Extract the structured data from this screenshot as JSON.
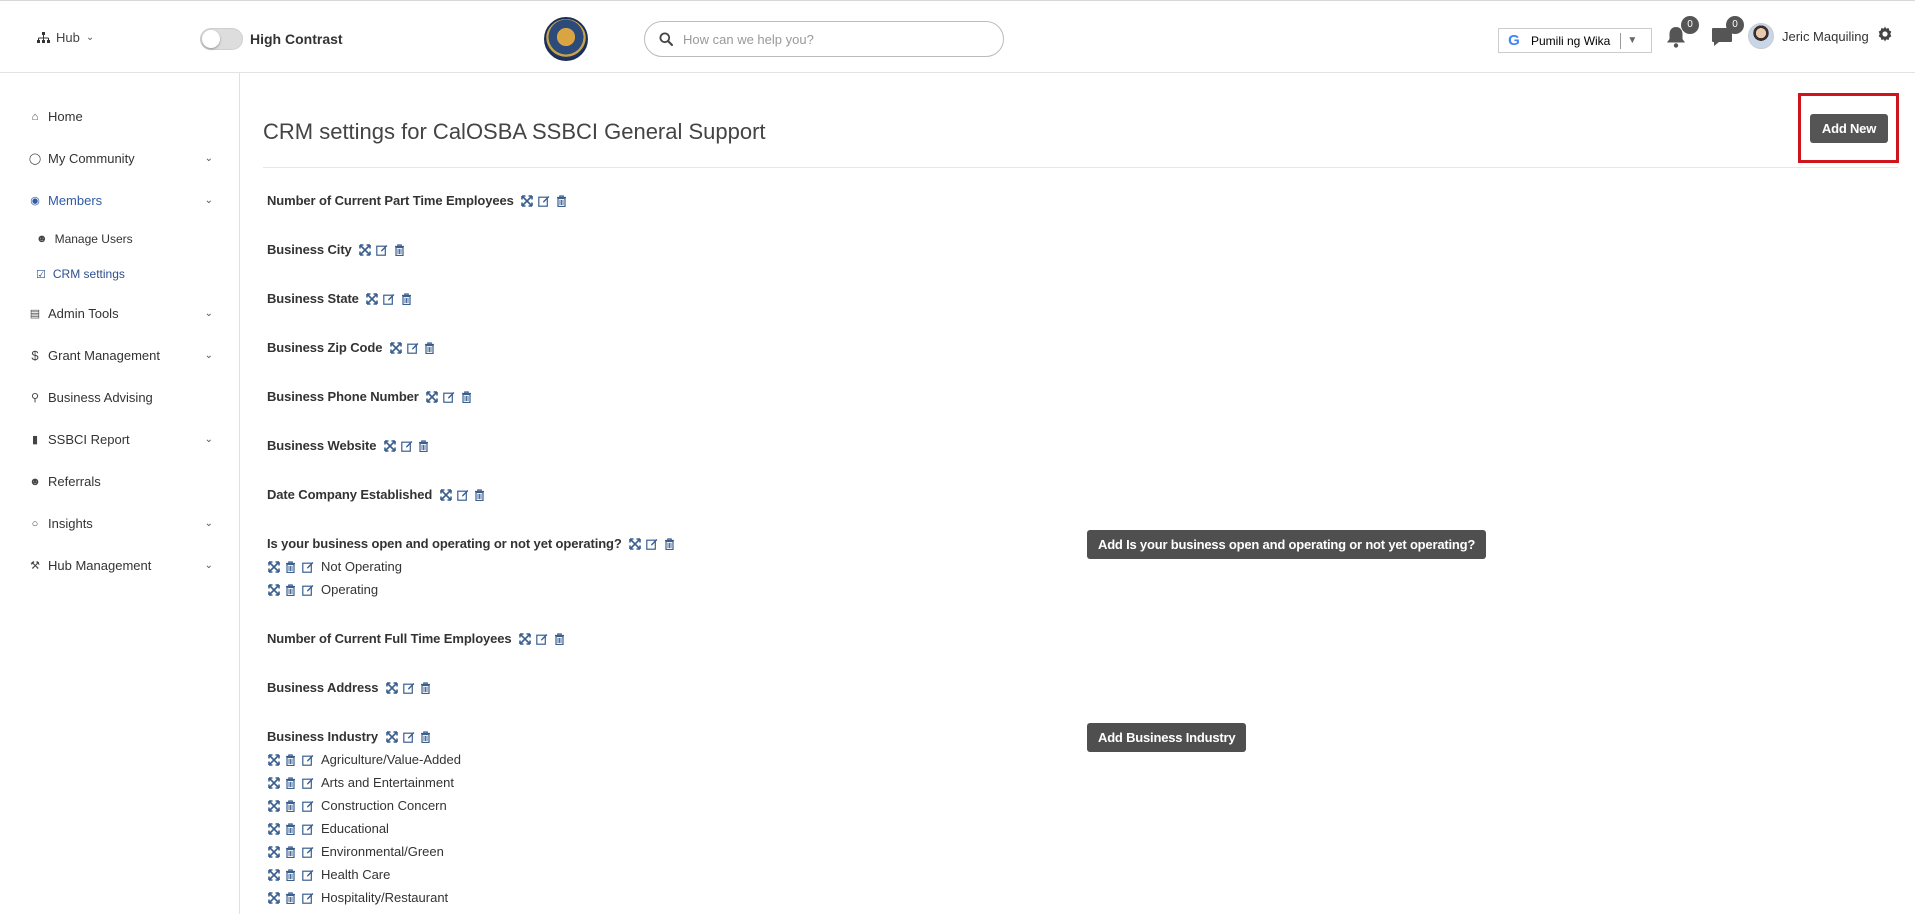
{
  "header": {
    "hub_label": "Hub",
    "high_contrast_label": "High Contrast",
    "search_placeholder": "How can we help you?",
    "translate_label": "Pumili ng Wika",
    "notifications_count": "0",
    "messages_count": "0",
    "user_name": "Jeric Maquiling"
  },
  "sidebar": {
    "items": [
      {
        "label": "Home",
        "icon": "home-icon"
      },
      {
        "label": "My Community",
        "icon": "community-icon"
      },
      {
        "label": "Members",
        "icon": "user-circle-icon"
      },
      {
        "label": "Manage Users",
        "icon": "users-icon"
      },
      {
        "label": "CRM settings",
        "icon": "check-square-icon"
      },
      {
        "label": "Admin Tools",
        "icon": "tools-icon"
      },
      {
        "label": "Grant Management",
        "icon": "dollar-icon"
      },
      {
        "label": "Business Advising",
        "icon": "key-icon"
      },
      {
        "label": "SSBCI Report",
        "icon": "file-icon"
      },
      {
        "label": "Referrals",
        "icon": "user-plus-icon"
      },
      {
        "label": "Insights",
        "icon": "lightbulb-icon"
      },
      {
        "label": "Hub Management",
        "icon": "wrench-icon"
      }
    ]
  },
  "main": {
    "title": "CRM settings for CalOSBA SSBCI General Support",
    "add_new_label": "Add New",
    "fields": [
      "Number of Current Part Time Employees",
      "Business City",
      "Business State",
      "Business Zip Code",
      "Business Phone Number",
      "Business Website",
      "Date Company Established",
      "Is your business open and operating or not yet operating?",
      "Number of Current Full Time Employees",
      "Business Address",
      "Business Industry"
    ],
    "operating_options": [
      "Not Operating",
      "Operating"
    ],
    "industry_options": [
      "Agriculture/Value-Added",
      "Arts and Entertainment",
      "Construction Concern",
      "Educational",
      "Environmental/Green",
      "Health Care",
      "Hospitality/Restaurant"
    ],
    "add_operating_label": "Add Is your business open and operating or not yet operating?",
    "add_industry_label": "Add Business Industry"
  },
  "colors": {
    "accent": "#2f5aa8",
    "button_dark": "#555555",
    "highlight_frame": "#d0141c",
    "icon_blue": "#3a5f8f"
  }
}
